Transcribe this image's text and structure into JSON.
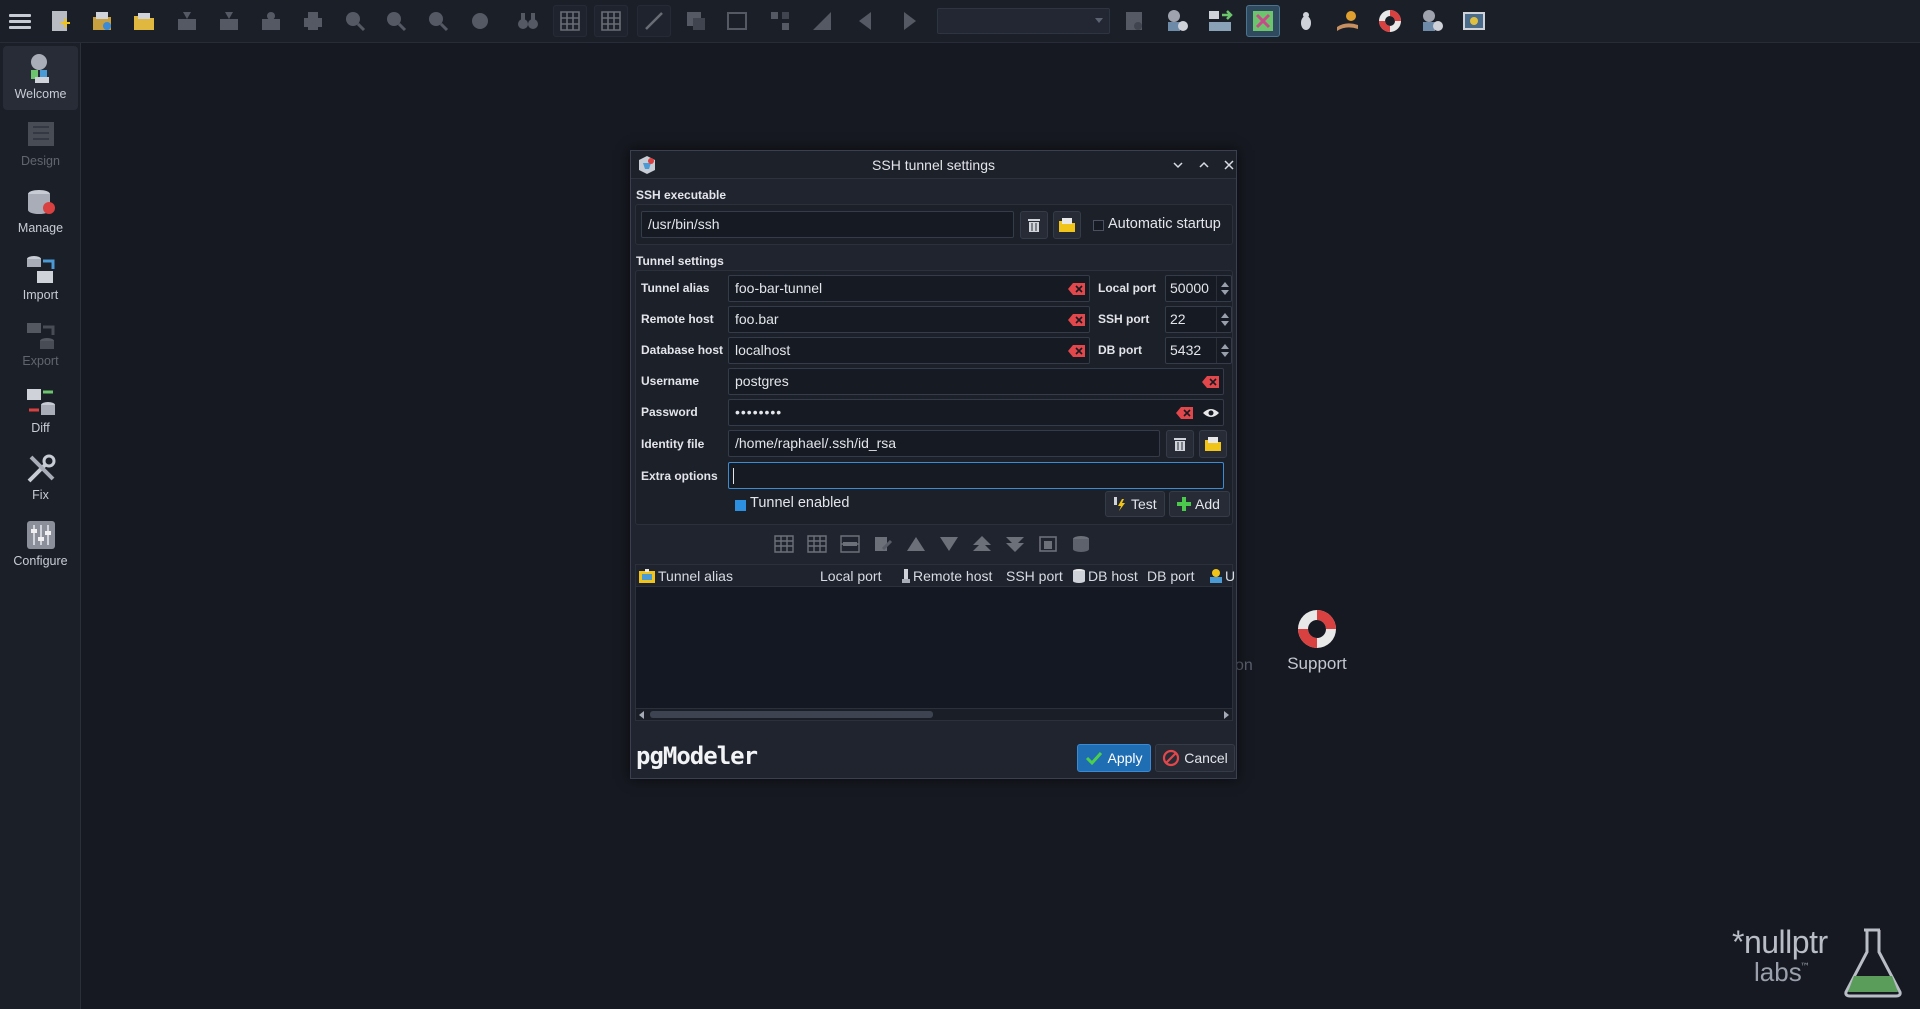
{
  "toolbar": {
    "buttons": [
      "menu-icon",
      "new-model-icon",
      "open-db-icon",
      "open-folder-icon",
      "save-icon",
      "save-as-icon",
      "export-icon",
      "print-icon",
      "zoom-out-icon",
      "zoom-reset-icon",
      "zoom-in-icon",
      "fit-icon",
      "find-icon",
      "grid-icon",
      "grid-align-icon",
      "line-icon",
      "overview-icon",
      "fullscreen-icon",
      "layers-icon",
      "arrange-icon",
      "prev-icon",
      "next-icon",
      "plugins-icon",
      "db-settings-icon",
      "import-settings-icon",
      "ssh-tunnel-icon",
      "bug-icon",
      "donate-icon",
      "support-icon",
      "update-icon",
      "about-icon"
    ],
    "model_selector_value": ""
  },
  "sidebar": {
    "items": [
      {
        "label": "Welcome",
        "icon": "welcome-icon"
      },
      {
        "label": "Design",
        "icon": "design-icon"
      },
      {
        "label": "Manage",
        "icon": "manage-icon"
      },
      {
        "label": "Import",
        "icon": "import-icon"
      },
      {
        "label": "Export",
        "icon": "export-icon"
      },
      {
        "label": "Diff",
        "icon": "diff-icon"
      },
      {
        "label": "Fix",
        "icon": "fix-icon"
      },
      {
        "label": "Configure",
        "icon": "configure-icon"
      }
    ]
  },
  "background": {
    "partial_text": "on",
    "support_label": "Support",
    "brand_line1": "*nullptr",
    "brand_line2": "labs",
    "brand_tm": "™"
  },
  "dialog": {
    "title": "SSH tunnel settings",
    "ssh_section": "SSH executable",
    "ssh_path": "/usr/bin/ssh",
    "auto_startup_label": "Automatic startup",
    "auto_startup_checked": false,
    "tunnel_section": "Tunnel settings",
    "labels": {
      "tunnel_alias": "Tunnel alias",
      "remote_host": "Remote host",
      "database_host": "Database host",
      "username": "Username",
      "password": "Password",
      "identity_file": "Identity file",
      "extra_options": "Extra options",
      "local_port": "Local port",
      "ssh_port": "SSH port",
      "db_port": "DB port"
    },
    "values": {
      "tunnel_alias": "foo-bar-tunnel",
      "remote_host": "foo.bar",
      "database_host": "localhost",
      "username": "postgres",
      "password": "••••••••",
      "identity_file": "/home/raphael/.ssh/id_rsa",
      "extra_options": "",
      "local_port": "50000",
      "ssh_port": "22",
      "db_port": "5432"
    },
    "tunnel_enabled_label": "Tunnel enabled",
    "tunnel_enabled_checked": true,
    "test_label": "Test",
    "add_label": "Add",
    "grid_columns": [
      "Tunnel alias",
      "Local port",
      "Remote host",
      "SSH port",
      "DB host",
      "DB port",
      "U"
    ],
    "grid_rows": [],
    "logo_text": "pgModeler",
    "apply_label": "Apply",
    "cancel_label": "Cancel"
  },
  "colors": {
    "accent": "#1f6db3",
    "clear_icon": "#e2474b",
    "folder": "#f0c419"
  }
}
